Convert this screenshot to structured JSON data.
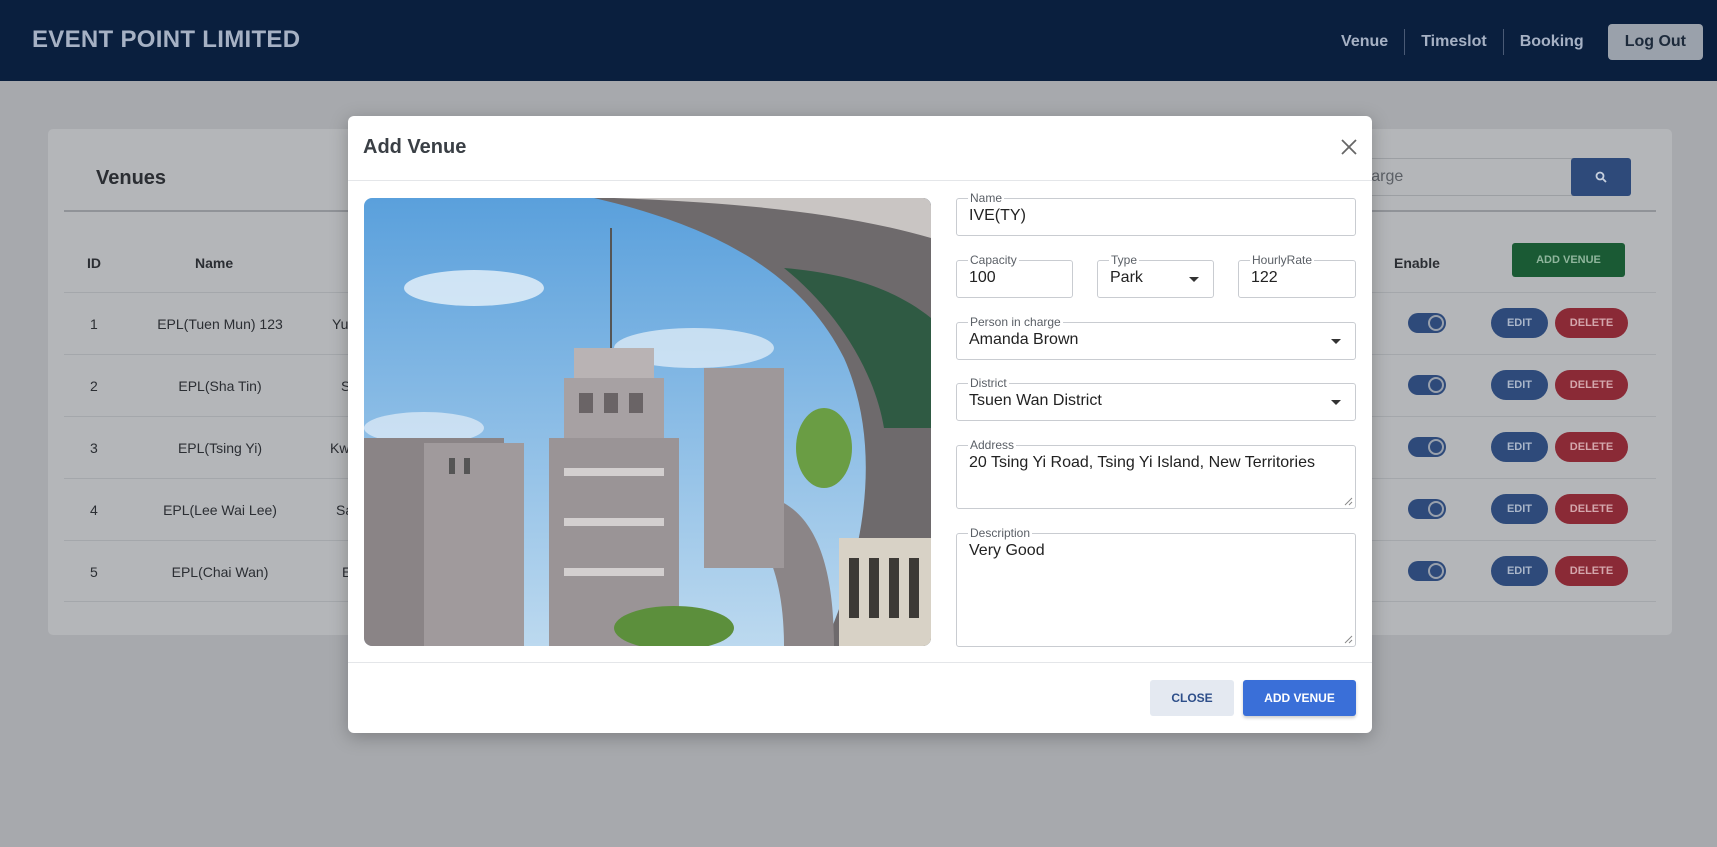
{
  "navbar": {
    "brand": "EVENT POINT LIMITED",
    "links": [
      "Venue",
      "Timeslot",
      "Booking"
    ],
    "logout": "Log Out"
  },
  "page": {
    "title": "Venues",
    "search_placeholder": "erson in charge",
    "columns": {
      "id": "ID",
      "name": "Name",
      "enable": "Enable"
    },
    "add_button": "ADD VENUE",
    "rows": [
      {
        "id": "1",
        "name": "EPL(Tuen Mun) 123",
        "partial": "Yu",
        "enabled": true
      },
      {
        "id": "2",
        "name": "EPL(Sha Tin)",
        "partial": "S",
        "enabled": true
      },
      {
        "id": "3",
        "name": "EPL(Tsing Yi)",
        "partial": "Kw",
        "enabled": true
      },
      {
        "id": "4",
        "name": "EPL(Lee Wai Lee)",
        "partial": "Sa",
        "enabled": true
      },
      {
        "id": "5",
        "name": "EPL(Chai Wan)",
        "partial": "E",
        "enabled": true
      }
    ],
    "edit_label": "EDIT",
    "delete_label": "DELETE"
  },
  "modal": {
    "title": "Add Venue",
    "fields": {
      "name": {
        "label": "Name",
        "value": "IVE(TY)"
      },
      "capacity": {
        "label": "Capacity",
        "value": "100"
      },
      "type": {
        "label": "Type",
        "value": "Park"
      },
      "hourly_rate": {
        "label": "HourlyRate",
        "value": "122"
      },
      "person_in_charge": {
        "label": "Person in charge",
        "value": "Amanda Brown"
      },
      "district": {
        "label": "District",
        "value": "Tsuen Wan District"
      },
      "address": {
        "label": "Address",
        "value": "20 Tsing Yi Road, Tsing Yi Island, New Territories"
      },
      "description": {
        "label": "Description",
        "value": "Very Good"
      }
    },
    "close_button": "CLOSE",
    "add_button": "ADD VENUE"
  },
  "colors": {
    "navbar": "#0a1f3e",
    "primary": "#3a6fd8",
    "danger": "#8a2a36",
    "success": "#1a5a34"
  }
}
